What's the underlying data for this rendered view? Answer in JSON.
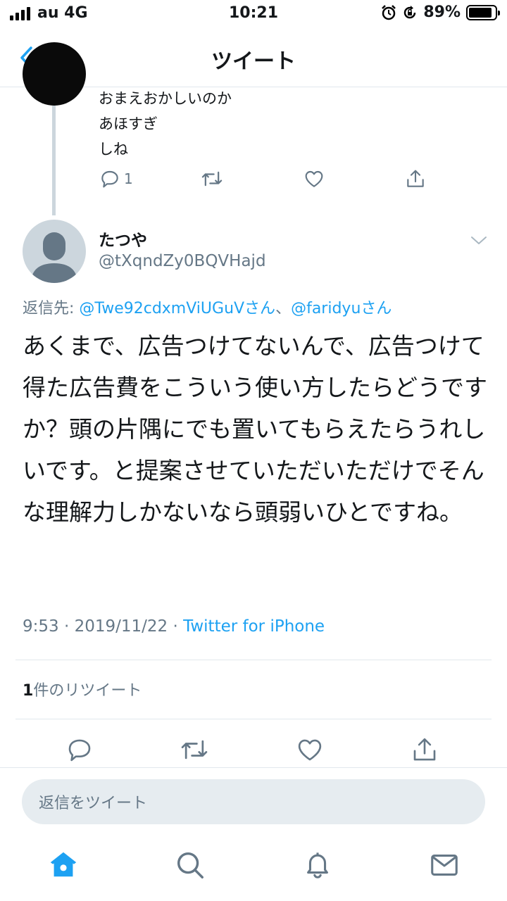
{
  "status_bar": {
    "carrier": "au 4G",
    "time": "10:21",
    "battery_percent": "89%",
    "battery_level": 0.89
  },
  "nav": {
    "title": "ツイート"
  },
  "previous_tweet": {
    "text": "おまえおかしいのか\nあほすぎ\nしね",
    "reply_count": "1"
  },
  "tweet": {
    "display_name": "たつや",
    "handle": "@tXqndZy0BQVHajd",
    "replying_label": "返信先: ",
    "replying_mention_1": "@Twe92cdxmViUGuVさん",
    "replying_separator": "、",
    "replying_mention_2": "@faridyuさん",
    "text": "あくまで、広告つけてないんで、広告つけて得た広告費をこういう使い方したらどうですか？頭の片隅にでも置いてもらえたらうれしいです。と提案させていただいただけでそんな理解力しかないなら頭弱いひとですね。",
    "time": "9:53",
    "date": "2019/11/22",
    "separator": " · ",
    "source": "Twitter for iPhone",
    "retweet_count": "1",
    "retweet_label": "件のリツイート"
  },
  "reply_bar": {
    "placeholder": "返信をツイート"
  },
  "colors": {
    "accent": "#1da1f2",
    "secondary_text": "#657786",
    "divider": "#e1e8ed"
  }
}
